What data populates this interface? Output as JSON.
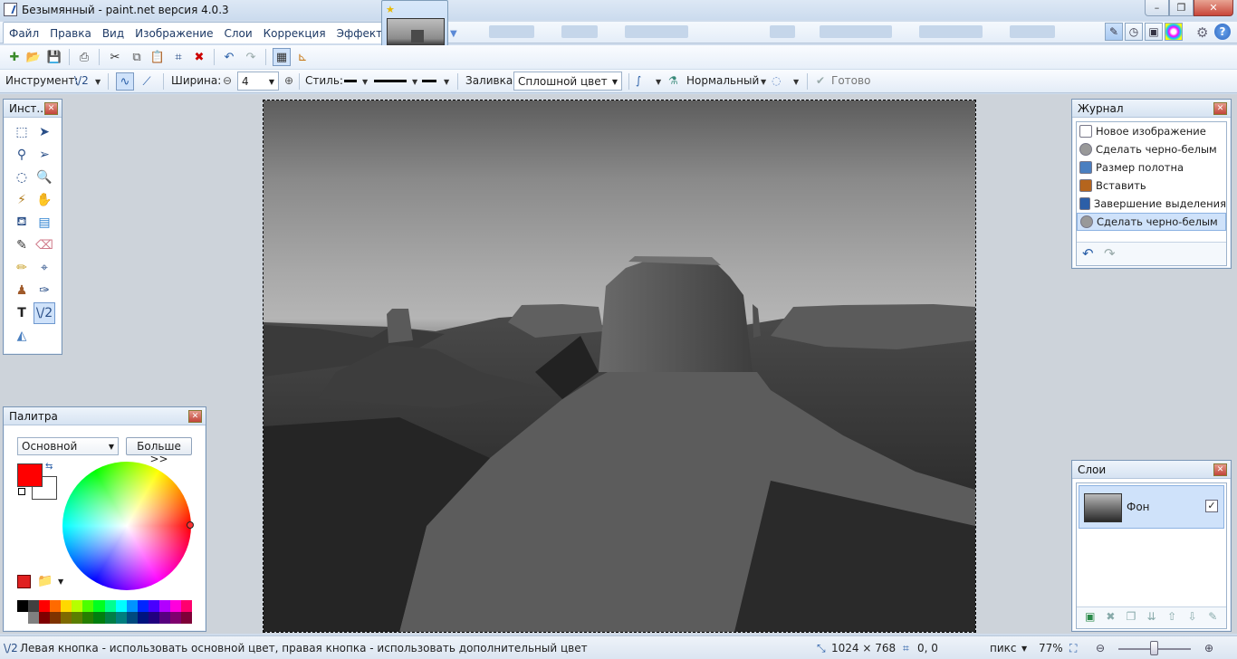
{
  "window": {
    "title": "Безымянный - paint.net версия 4.0.3",
    "min_glyph": "–",
    "max_glyph": "❐",
    "close_glyph": "✕"
  },
  "menu": [
    "Файл",
    "Правка",
    "Вид",
    "Изображение",
    "Слои",
    "Коррекция",
    "Эффекты"
  ],
  "toolbar2": {
    "instrument_label": "Инструмент:",
    "width_label": "Ширина:",
    "width_value": "4",
    "style_label": "Стиль:",
    "fill_label": "Заливка:",
    "fill_value": "Сплошной цвет",
    "blend_value": "Нормальный",
    "done_label": "Готово"
  },
  "panels": {
    "tools_title": "Инст...",
    "palette_title": "Палитра",
    "journal_title": "Журнал",
    "layers_title": "Слои"
  },
  "palette": {
    "mode": "Основной",
    "more_button": "Больше >>",
    "primary_color": "#ff0000",
    "secondary_color": "#ffffff",
    "swatches": [
      "#000000",
      "#404040",
      "#ff0000",
      "#ff6a00",
      "#ffd800",
      "#b6ff00",
      "#4cff00",
      "#00ff21",
      "#00ff90",
      "#00ffff",
      "#0094ff",
      "#0026ff",
      "#4800ff",
      "#b200ff",
      "#ff00dc",
      "#ff006e",
      "#ffffff",
      "#808080",
      "#7f0000",
      "#7f3300",
      "#7f6a00",
      "#5b7f00",
      "#267f00",
      "#007f0e",
      "#007f46",
      "#007f7f",
      "#004a7f",
      "#00137f",
      "#21007f",
      "#57007f",
      "#7f006e",
      "#7f0037"
    ]
  },
  "journal": {
    "items": [
      {
        "label": "Новое изображение",
        "icon": "new-image-icon",
        "color": "#ffffff"
      },
      {
        "label": "Сделать черно-белым",
        "icon": "black-white-icon",
        "color": "#999999"
      },
      {
        "label": "Размер полотна",
        "icon": "canvas-size-icon",
        "color": "#4a7fc0"
      },
      {
        "label": "Вставить",
        "icon": "paste-icon",
        "color": "#b5651d"
      },
      {
        "label": "Завершение выделения",
        "icon": "finish-selection-icon",
        "color": "#2c5fa8"
      },
      {
        "label": "Сделать черно-белым",
        "icon": "black-white-icon",
        "color": "#999999"
      }
    ],
    "selected_index": 5
  },
  "layers": {
    "items": [
      {
        "name": "Фон",
        "visible": true
      }
    ]
  },
  "status": {
    "hint": "Левая кнопка - использовать основной цвет, правая кнопка - использовать дополнительный цвет",
    "image_size": "1024 × 768",
    "cursor_pos": "0, 0",
    "units": "пикс",
    "zoom": "77%"
  }
}
